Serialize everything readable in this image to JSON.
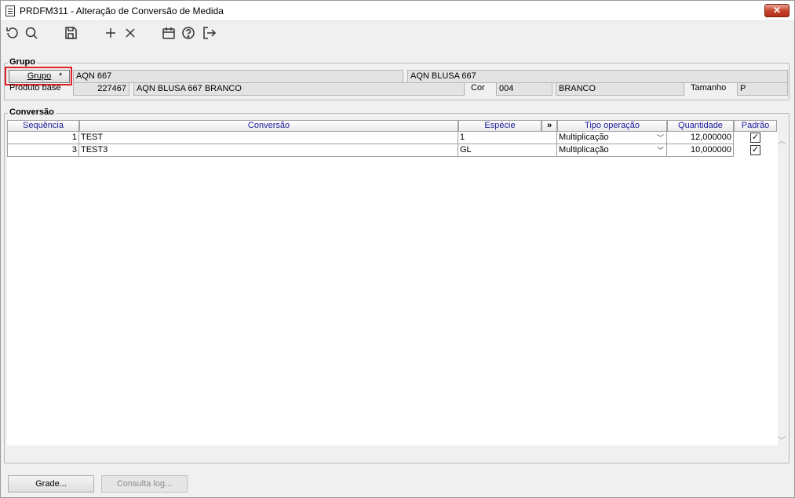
{
  "window": {
    "title": "PRDFM311 - Alteração de Conversão de Medida",
    "close_label": "✕"
  },
  "toolbar": {
    "icons": [
      "undo-icon",
      "search-icon",
      "save-icon",
      "add-icon",
      "delete-icon",
      "calendar-icon",
      "help-icon",
      "exit-icon"
    ]
  },
  "grupo": {
    "section_label": "Grupo",
    "button_label": "Grupo",
    "button_required": "*",
    "code": "AQN 667",
    "description": "AQN BLUSA 667",
    "produto_base_label": "Produto base",
    "produto_base_code": "227467",
    "produto_base_description": "AQN BLUSA 667 BRANCO",
    "cor_label": "Cor",
    "cor_code": "004",
    "cor_description": "BRANCO",
    "tamanho_label": "Tamanho",
    "tamanho_value": "P"
  },
  "conversao": {
    "section_label": "Conversão",
    "columns": {
      "sequencia": "Sequência",
      "conversao": "Conversão",
      "especie": "Espécie",
      "expand": "»",
      "tipo_operacao": "Tipo operação",
      "quantidade": "Quantidade",
      "padrao": "Padrão"
    },
    "rows": [
      {
        "sequencia": "1",
        "conversao": "TEST",
        "especie": "1",
        "tipo_operacao": "Multiplicação",
        "quantidade": "12,000000",
        "padrao": true
      },
      {
        "sequencia": "3",
        "conversao": "TEST3",
        "especie": "GL",
        "tipo_operacao": "Multiplicação",
        "quantidade": "10,000000",
        "padrao": true
      }
    ]
  },
  "footer": {
    "grade_label": "Grade...",
    "consulta_log_label": "Consulta log..."
  }
}
